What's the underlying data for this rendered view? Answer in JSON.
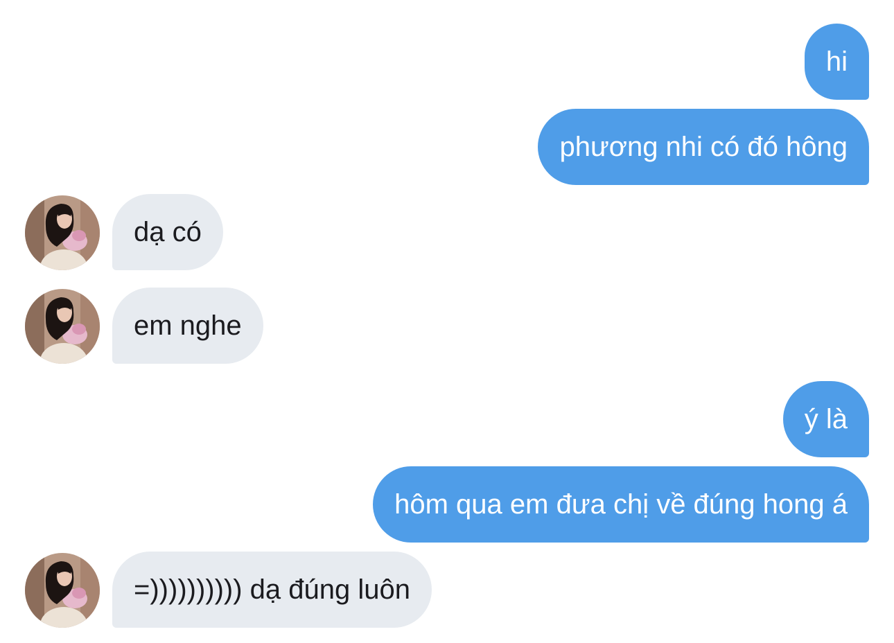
{
  "chat": {
    "messages": [
      {
        "from": "me",
        "text": "hi"
      },
      {
        "from": "me",
        "text": "phương nhi có đó hông"
      },
      {
        "from": "them",
        "text": "dạ có"
      },
      {
        "from": "them",
        "text": "em nghe"
      },
      {
        "from": "me",
        "text": "ý là"
      },
      {
        "from": "me",
        "text": "hôm qua em đưa chị về đúng hong á"
      },
      {
        "from": "them",
        "text": "=)))))))))) dạ đúng luôn"
      }
    ]
  },
  "colors": {
    "sent_bubble": "#4f9de8",
    "received_bubble": "#e7ebf0",
    "sent_text": "#ffffff",
    "received_text": "#1b1b1f"
  },
  "icons": {
    "contact_avatar": "avatar-photo"
  }
}
